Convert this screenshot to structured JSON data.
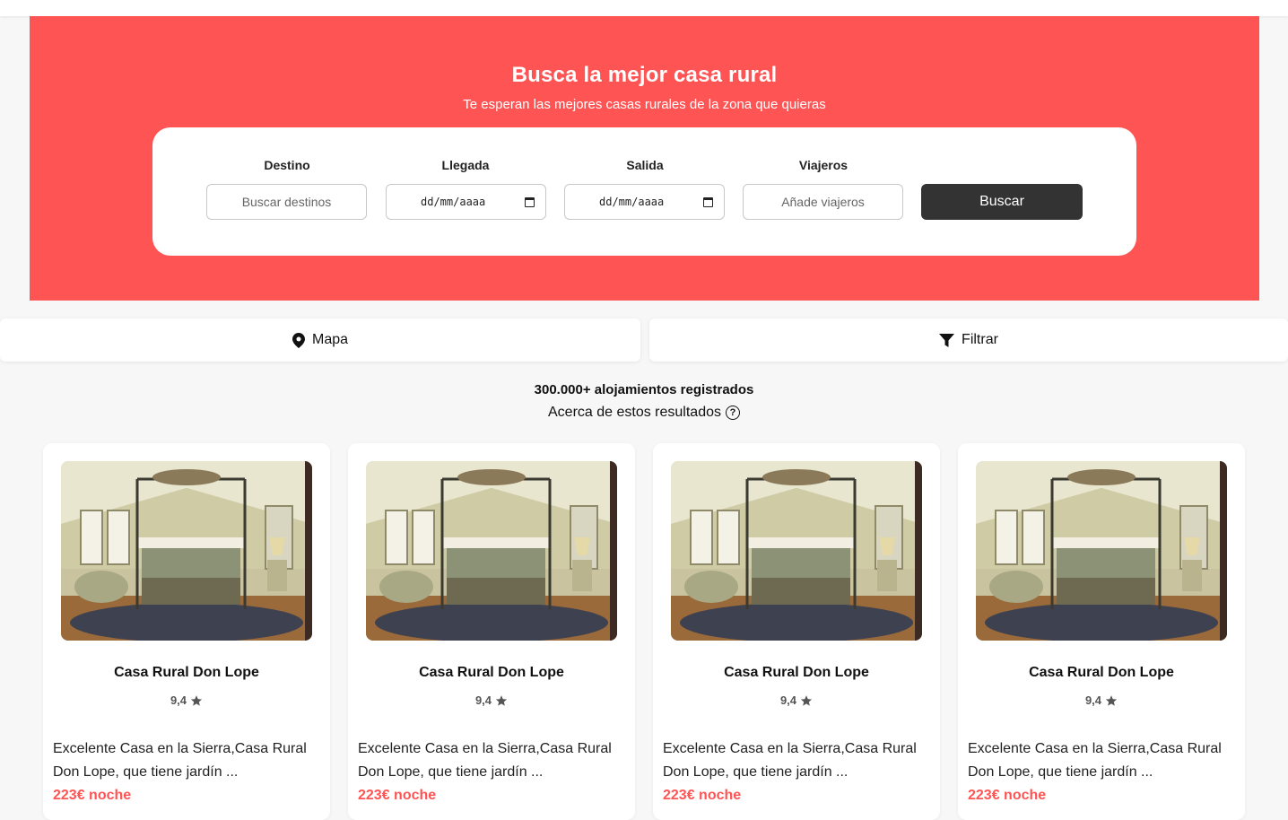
{
  "hero": {
    "title": "Busca la mejor casa rural",
    "subtitle": "Te esperan las mejores casas rurales de la zona que quieras",
    "background_color": "#fe5454"
  },
  "search": {
    "destino_label": "Destino",
    "destino_placeholder": "Buscar destinos",
    "llegada_label": "Llegada",
    "llegada_placeholder": "dd/mm/aaaa",
    "salida_label": "Salida",
    "salida_placeholder": "dd/mm/aaaa",
    "viajeros_label": "Viajeros",
    "viajeros_placeholder": "Añade viajeros",
    "button_label": "Buscar",
    "button_color": "#333333"
  },
  "toolbar": {
    "map_label": "Mapa",
    "map_icon": "map-pin-icon",
    "filter_label": "Filtrar",
    "filter_icon": "filter-icon"
  },
  "results": {
    "count_text": "300.000+ alojamientos registrados",
    "about_text": "Acerca de estos resultados",
    "about_icon": "help-circle-icon"
  },
  "listings": [
    {
      "title": "Casa Rural Don Lope",
      "rating": "9,4",
      "description": "Excelente Casa en la Sierra,Casa Rural Don Lope, que tiene jardín ...",
      "price": "223€ noche"
    },
    {
      "title": "Casa Rural Don Lope",
      "rating": "9,4",
      "description": "Excelente Casa en la Sierra,Casa Rural Don Lope, que tiene jardín ...",
      "price": "223€ noche"
    },
    {
      "title": "Casa Rural Don Lope",
      "rating": "9,4",
      "description": "Excelente Casa en la Sierra,Casa Rural Don Lope, que tiene jardín ...",
      "price": "223€ noche"
    },
    {
      "title": "Casa Rural Don Lope",
      "rating": "9,4",
      "description": "Excelente Casa en la Sierra,Casa Rural Don Lope, que tiene jardín ...",
      "price": "223€ noche"
    }
  ],
  "price_color": "#fe5454"
}
